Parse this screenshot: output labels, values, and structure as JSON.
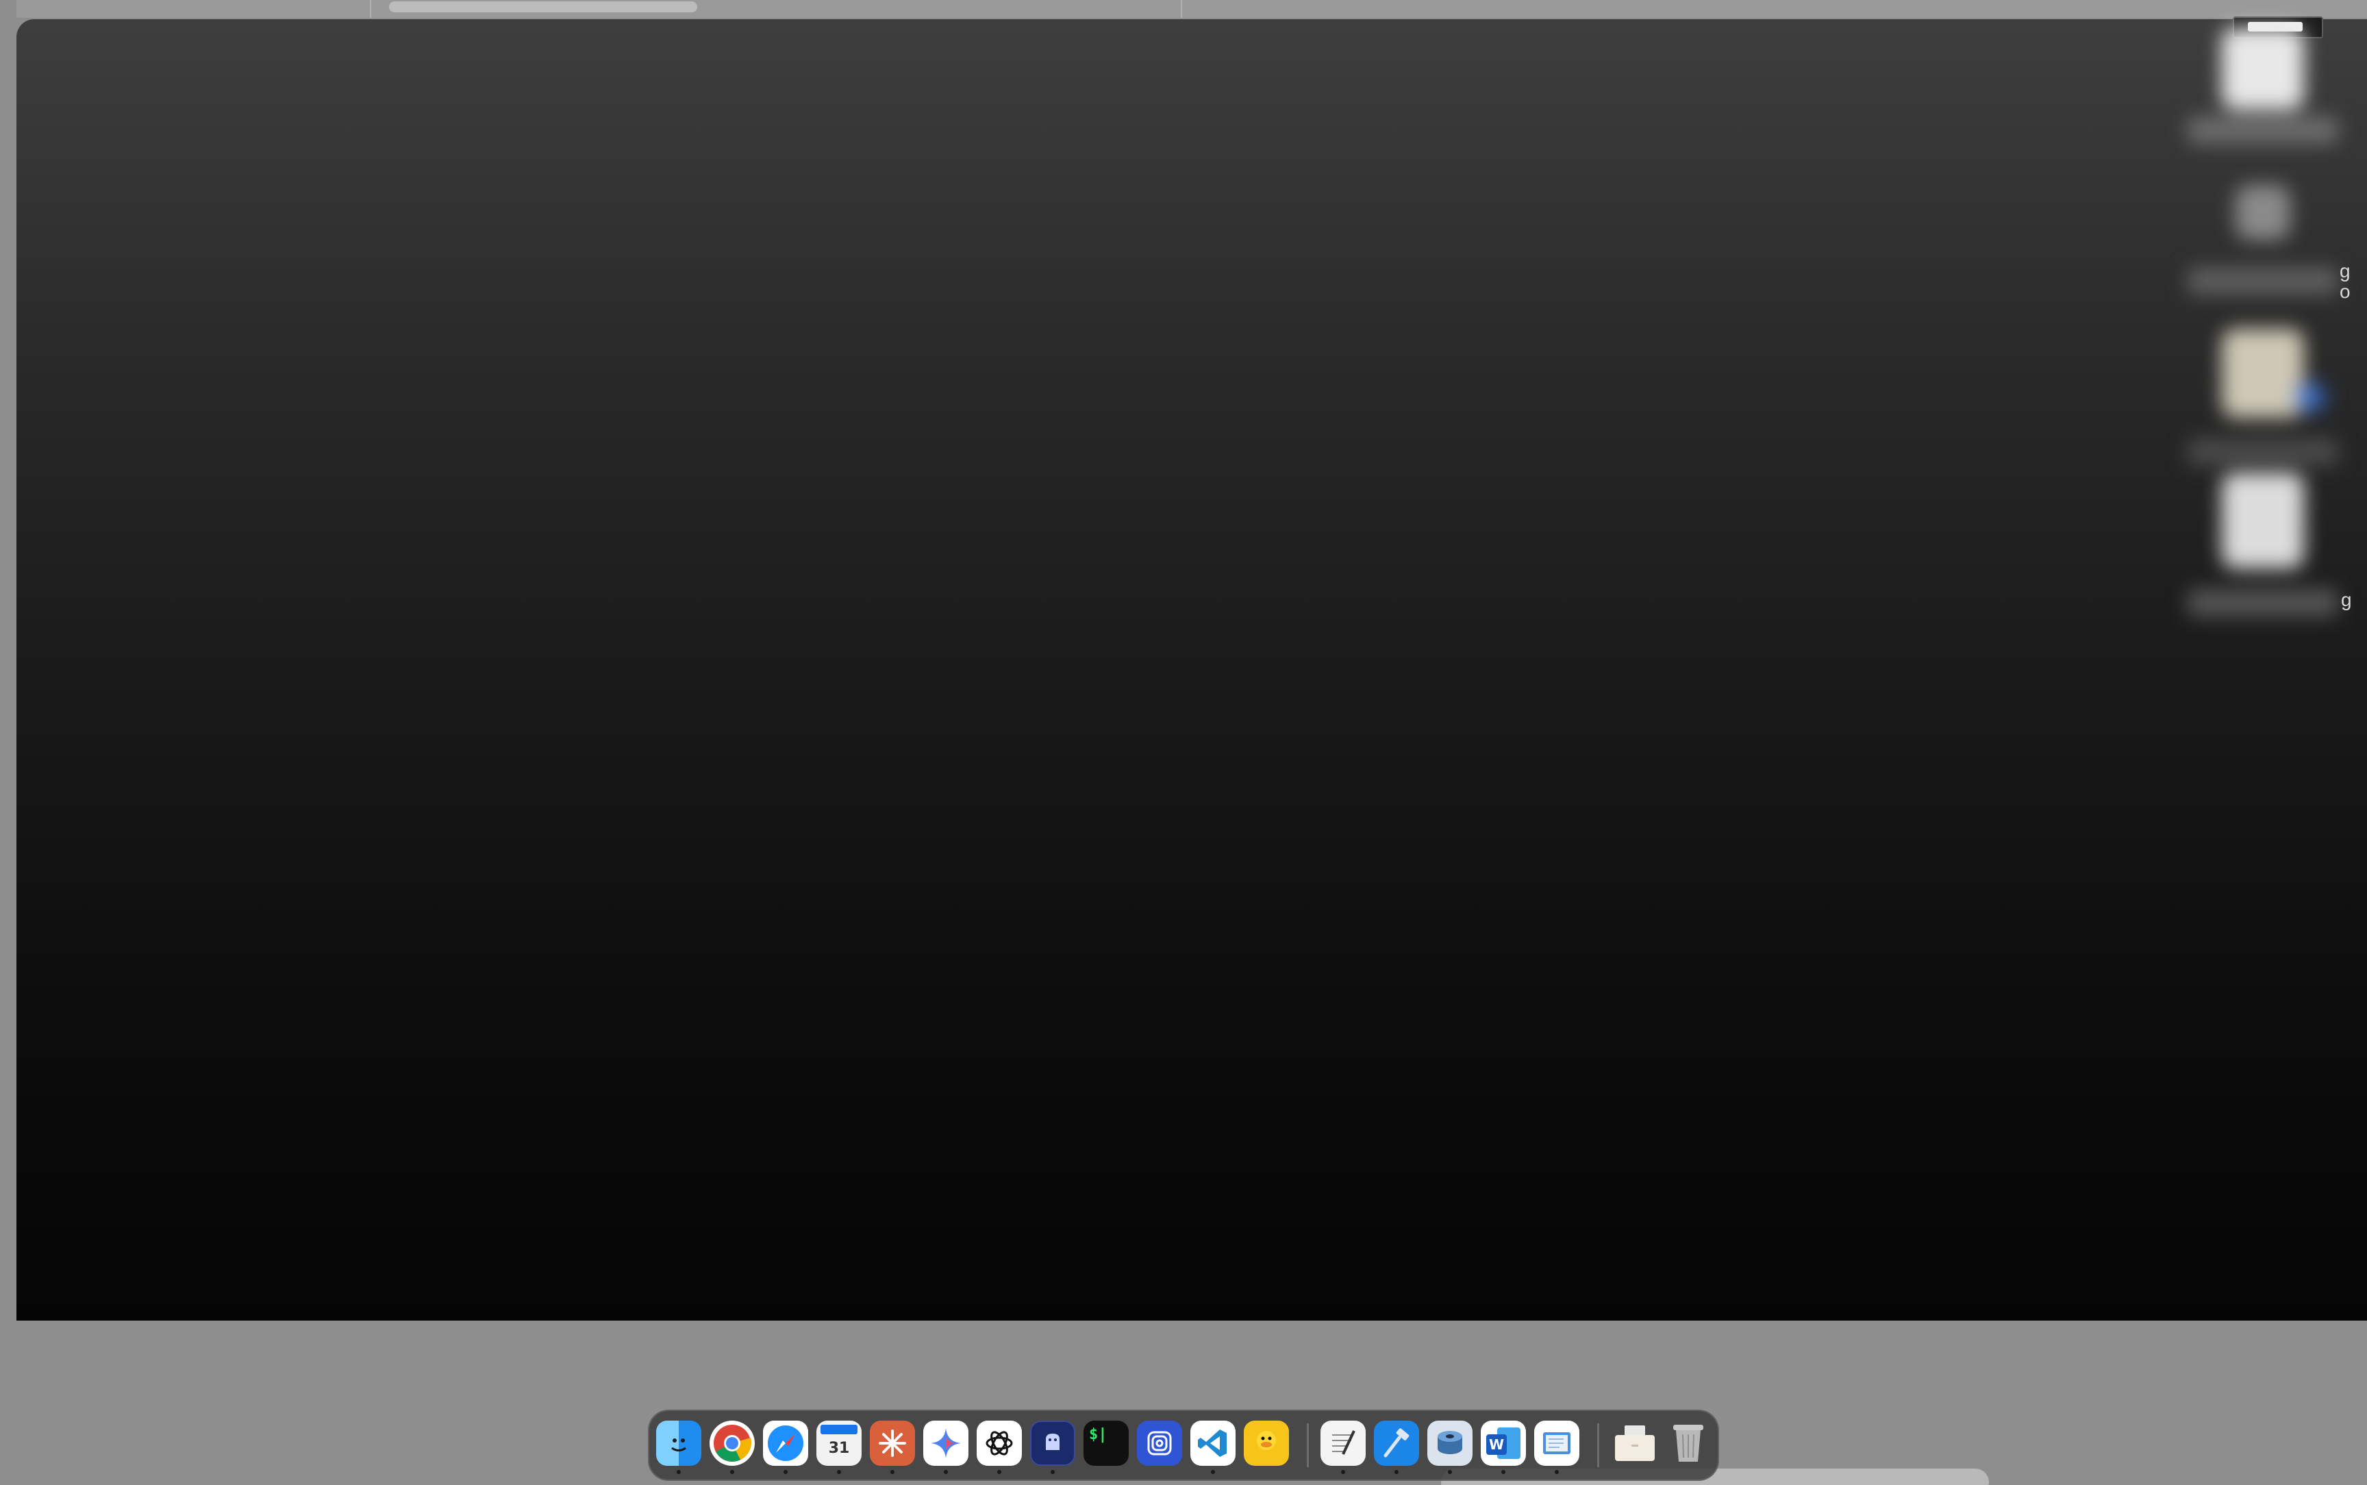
{
  "screen": {
    "overlay_gradient_top": "#3e3e3e",
    "overlay_gradient_bottom": "#050505",
    "frame_color": "#8e8e8e"
  },
  "edge_text": {
    "glyph_1": "g",
    "glyph_2": "o",
    "glyph_3": "g"
  },
  "dock": {
    "items": [
      {
        "name": "finder",
        "icon": "finder-icon",
        "running": true
      },
      {
        "name": "chrome",
        "icon": "chrome-icon",
        "running": true
      },
      {
        "name": "safari",
        "icon": "safari-icon",
        "running": true
      },
      {
        "name": "calendar",
        "icon": "calendar-icon",
        "label": "31",
        "running": true
      },
      {
        "name": "claude",
        "icon": "claude-icon",
        "running": true
      },
      {
        "name": "gemini",
        "icon": "sparkle-icon",
        "running": true
      },
      {
        "name": "chatgpt",
        "icon": "chatgpt-icon",
        "running": true
      },
      {
        "name": "app-dark-blue",
        "icon": "ghost-icon",
        "running": true
      },
      {
        "name": "terminal",
        "icon": "terminal-icon",
        "label": "$|",
        "running": false
      },
      {
        "name": "app-spiral",
        "icon": "spiral-icon",
        "running": false
      },
      {
        "name": "vscode",
        "icon": "vscode-icon",
        "running": true
      },
      {
        "name": "cyberduck",
        "icon": "duck-icon",
        "running": false
      },
      {
        "name": "textedit",
        "icon": "textedit-icon",
        "running": true
      },
      {
        "name": "xcode",
        "icon": "hammer-icon",
        "running": true
      },
      {
        "name": "app-disk",
        "icon": "disk-icon",
        "running": true
      },
      {
        "name": "word",
        "icon": "word-icon",
        "label": "W",
        "running": true
      },
      {
        "name": "preview",
        "icon": "preview-icon",
        "running": true
      },
      {
        "name": "downloads",
        "icon": "folder-icon",
        "running": false
      },
      {
        "name": "trash",
        "icon": "trash-icon",
        "running": false
      }
    ]
  }
}
